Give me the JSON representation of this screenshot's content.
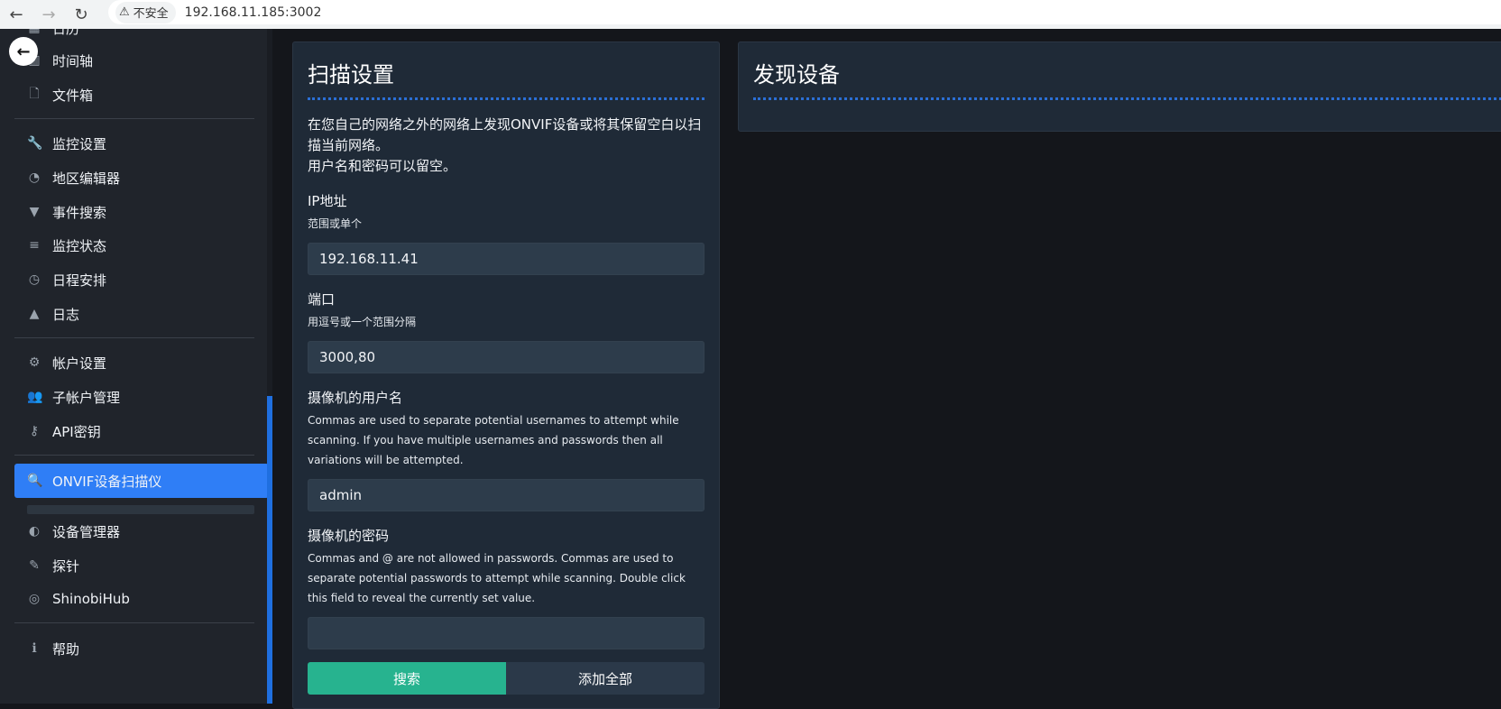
{
  "browser": {
    "security_label": "不安全",
    "url": "192.168.11.185:3002"
  },
  "sidebar": {
    "items": [
      {
        "label": "日历",
        "icon": "calendar-icon",
        "glyph": "▦"
      },
      {
        "label": "时间轴",
        "icon": "timeline-icon",
        "glyph": "▥"
      },
      {
        "label": "文件箱",
        "icon": "file-icon",
        "glyph": "🗋"
      },
      {
        "label": "监控设置",
        "icon": "wrench-icon",
        "glyph": "🔧"
      },
      {
        "label": "地区编辑器",
        "icon": "region-icon",
        "glyph": "◔"
      },
      {
        "label": "事件搜索",
        "icon": "filter-icon",
        "glyph": "▼"
      },
      {
        "label": "监控状态",
        "icon": "list-icon",
        "glyph": "≡"
      },
      {
        "label": "日程安排",
        "icon": "clock-icon",
        "glyph": "◷"
      },
      {
        "label": "日志",
        "icon": "warning-icon",
        "glyph": "▲"
      },
      {
        "label": "帐户设置",
        "icon": "gears-icon",
        "glyph": "⚙"
      },
      {
        "label": "子帐户管理",
        "icon": "users-icon",
        "glyph": "👥"
      },
      {
        "label": "API密钥",
        "icon": "key-icon",
        "glyph": "⚷"
      },
      {
        "label": "ONVIF设备扫描仪",
        "icon": "search-icon",
        "glyph": "🔍"
      },
      {
        "label": "设备管理器",
        "icon": "circle-half-icon",
        "glyph": "◐"
      },
      {
        "label": "探针",
        "icon": "eyedropper-icon",
        "glyph": "✎"
      },
      {
        "label": "ShinobiHub",
        "icon": "compass-icon",
        "glyph": "◎"
      },
      {
        "label": "帮助",
        "icon": "info-icon",
        "glyph": "ℹ"
      }
    ]
  },
  "scan": {
    "title": "扫描设置",
    "intro_line1": "在您自己的网络之外的网络上发现ONVIF设备或将其保留空白以扫描当前网络。",
    "intro_line2": "用户名和密码可以留空。",
    "ip_label": "IP地址",
    "ip_help": "范围或单个",
    "ip_value": "192.168.11.41",
    "port_label": "端口",
    "port_help": "用逗号或一个范围分隔",
    "port_value": "3000,80",
    "user_label": "摄像机的用户名",
    "user_help": "Commas are used to separate potential usernames to attempt while scanning. If you have multiple usernames and passwords then all variations will be attempted.",
    "user_value": "admin",
    "pass_label": "摄像机的密码",
    "pass_help": "Commas and @ are not allowed in passwords. Commas are used to separate potential passwords to attempt while scanning. Double click this field to reveal the currently set value.",
    "pass_value": "",
    "search_button": "搜索",
    "add_all_button": "添加全部"
  },
  "found": {
    "title": "发现设备"
  }
}
